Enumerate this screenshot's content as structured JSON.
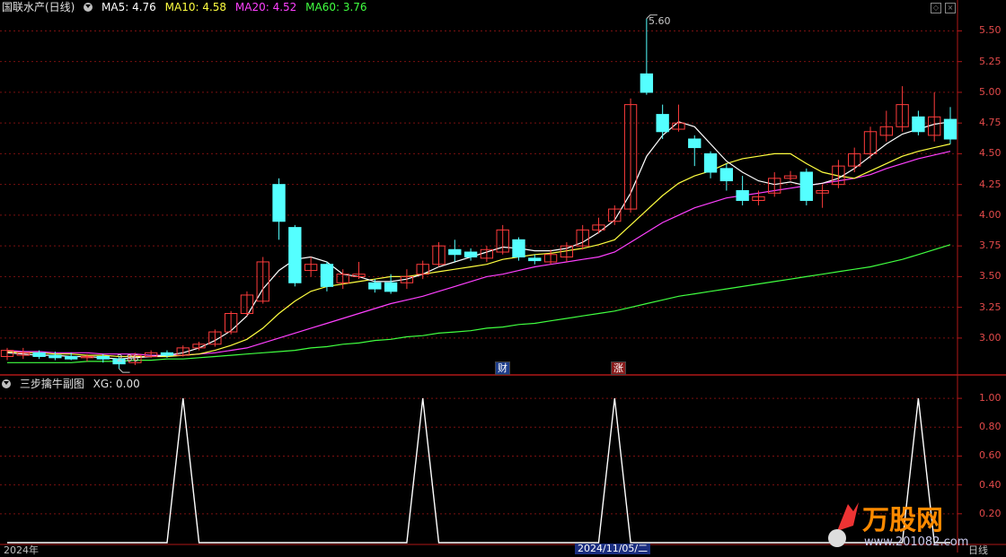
{
  "main": {
    "title": "国联水产(日线)",
    "ma": [
      {
        "label": "MA5: 4.76",
        "color": "#ffffff"
      },
      {
        "label": "MA10: 4.58",
        "color": "#ffff40"
      },
      {
        "label": "MA20: 4.52",
        "color": "#ff40ff"
      },
      {
        "label": "MA60: 3.76",
        "color": "#40ff40"
      }
    ],
    "axis_ticks": [
      "5.50",
      "5.25",
      "5.00",
      "4.75",
      "4.50",
      "4.25",
      "4.00",
      "3.75",
      "3.50",
      "3.25",
      "3.00"
    ],
    "high_note": "5.60",
    "low_note": "2.86",
    "tag_cai": "财",
    "tag_zhang": "涨"
  },
  "sub": {
    "title": "三步擒牛副图",
    "value": "XG: 0.00",
    "axis_ticks": [
      "1.00",
      "0.80",
      "0.60",
      "0.40",
      "0.20"
    ]
  },
  "bottom": {
    "left_year": "2024年",
    "date_box": "2024/11/05/二",
    "right_label": "日线"
  },
  "colors": {
    "bg": "#000000",
    "up": "#ff3c3c",
    "down": "#54ffff",
    "grid": "#7a1010",
    "ma5": "#ffffff",
    "ma10": "#ffff40",
    "ma20": "#ff40ff",
    "ma60": "#40ff40",
    "axis": "#b01818"
  },
  "chart_data": {
    "type": "candlestick",
    "y_range": [
      2.7,
      5.62
    ],
    "sub_y_range": [
      0,
      1.1
    ],
    "candles": [
      [
        2.85,
        2.9,
        2.92,
        2.82
      ],
      [
        2.86,
        2.88,
        2.92,
        2.83
      ],
      [
        2.88,
        2.85,
        2.9,
        2.83
      ],
      [
        2.86,
        2.84,
        2.89,
        2.82
      ],
      [
        2.85,
        2.83,
        2.88,
        2.82
      ],
      [
        2.84,
        2.85,
        2.87,
        2.81
      ],
      [
        2.85,
        2.83,
        2.87,
        2.8
      ],
      [
        2.83,
        2.79,
        2.85,
        2.75
      ],
      [
        2.8,
        2.86,
        2.88,
        2.78
      ],
      [
        2.85,
        2.88,
        2.9,
        2.84
      ],
      [
        2.88,
        2.86,
        2.9,
        2.84
      ],
      [
        2.86,
        2.92,
        2.94,
        2.85
      ],
      [
        2.92,
        2.95,
        2.97,
        2.9
      ],
      [
        2.95,
        3.05,
        3.07,
        2.93
      ],
      [
        3.05,
        3.2,
        3.22,
        3.03
      ],
      [
        3.2,
        3.35,
        3.38,
        3.18
      ],
      [
        3.3,
        3.62,
        3.66,
        3.28
      ],
      [
        4.25,
        3.95,
        4.3,
        3.8
      ],
      [
        3.9,
        3.45,
        3.92,
        3.42
      ],
      [
        3.55,
        3.6,
        3.66,
        3.5
      ],
      [
        3.6,
        3.42,
        3.62,
        3.38
      ],
      [
        3.45,
        3.52,
        3.56,
        3.4
      ],
      [
        3.5,
        3.52,
        3.62,
        3.48
      ],
      [
        3.45,
        3.4,
        3.48,
        3.37
      ],
      [
        3.45,
        3.38,
        3.52,
        3.36
      ],
      [
        3.45,
        3.5,
        3.56,
        3.4
      ],
      [
        3.52,
        3.6,
        3.63,
        3.48
      ],
      [
        3.6,
        3.75,
        3.78,
        3.58
      ],
      [
        3.72,
        3.68,
        3.8,
        3.62
      ],
      [
        3.7,
        3.66,
        3.73,
        3.63
      ],
      [
        3.65,
        3.72,
        3.75,
        3.62
      ],
      [
        3.7,
        3.88,
        3.92,
        3.68
      ],
      [
        3.8,
        3.66,
        3.82,
        3.63
      ],
      [
        3.65,
        3.63,
        3.68,
        3.6
      ],
      [
        3.62,
        3.68,
        3.72,
        3.6
      ],
      [
        3.66,
        3.75,
        3.78,
        3.62
      ],
      [
        3.75,
        3.88,
        3.92,
        3.72
      ],
      [
        3.88,
        3.92,
        3.98,
        3.85
      ],
      [
        3.95,
        4.05,
        4.08,
        3.92
      ],
      [
        4.05,
        4.9,
        4.95,
        4.02
      ],
      [
        5.15,
        5.0,
        5.6,
        4.98
      ],
      [
        4.82,
        4.68,
        4.9,
        4.62
      ],
      [
        4.7,
        4.75,
        4.9,
        4.68
      ],
      [
        4.62,
        4.55,
        4.65,
        4.4
      ],
      [
        4.5,
        4.35,
        4.52,
        4.3
      ],
      [
        4.38,
        4.28,
        4.42,
        4.2
      ],
      [
        4.2,
        4.12,
        4.32,
        4.08
      ],
      [
        4.12,
        4.15,
        4.2,
        4.08
      ],
      [
        4.18,
        4.3,
        4.35,
        4.15
      ],
      [
        4.3,
        4.32,
        4.36,
        4.28
      ],
      [
        4.35,
        4.12,
        4.38,
        4.08
      ],
      [
        4.18,
        4.2,
        4.25,
        4.06
      ],
      [
        4.25,
        4.4,
        4.45,
        4.22
      ],
      [
        4.4,
        4.5,
        4.55,
        4.35
      ],
      [
        4.5,
        4.68,
        4.72,
        4.46
      ],
      [
        4.65,
        4.72,
        4.85,
        4.6
      ],
      [
        4.72,
        4.9,
        5.05,
        4.68
      ],
      [
        4.8,
        4.68,
        4.85,
        4.65
      ],
      [
        4.65,
        4.8,
        5.0,
        4.6
      ],
      [
        4.78,
        4.62,
        4.88,
        4.58
      ]
    ],
    "ma5": [
      2.88,
      2.87,
      2.86,
      2.86,
      2.85,
      2.85,
      2.84,
      2.83,
      2.84,
      2.85,
      2.86,
      2.88,
      2.92,
      2.98,
      3.06,
      3.18,
      3.4,
      3.55,
      3.64,
      3.66,
      3.62,
      3.52,
      3.5,
      3.46,
      3.46,
      3.48,
      3.52,
      3.58,
      3.62,
      3.66,
      3.7,
      3.74,
      3.73,
      3.71,
      3.71,
      3.73,
      3.78,
      3.86,
      3.96,
      4.18,
      4.48,
      4.65,
      4.76,
      4.72,
      4.58,
      4.44,
      4.35,
      4.28,
      4.25,
      4.27,
      4.24,
      4.26,
      4.3,
      4.38,
      4.48,
      4.58,
      4.66,
      4.7,
      4.74,
      4.76
    ],
    "ma10": [
      2.89,
      2.88,
      2.88,
      2.87,
      2.87,
      2.86,
      2.86,
      2.85,
      2.85,
      2.85,
      2.85,
      2.86,
      2.87,
      2.9,
      2.94,
      2.99,
      3.08,
      3.2,
      3.3,
      3.38,
      3.42,
      3.44,
      3.46,
      3.48,
      3.5,
      3.5,
      3.52,
      3.54,
      3.56,
      3.58,
      3.6,
      3.64,
      3.66,
      3.68,
      3.69,
      3.71,
      3.73,
      3.76,
      3.8,
      3.92,
      4.04,
      4.16,
      4.26,
      4.32,
      4.36,
      4.42,
      4.46,
      4.48,
      4.5,
      4.5,
      4.42,
      4.35,
      4.32,
      4.3,
      4.36,
      4.42,
      4.48,
      4.52,
      4.55,
      4.58
    ],
    "ma20": [
      2.9,
      2.89,
      2.89,
      2.88,
      2.88,
      2.88,
      2.87,
      2.87,
      2.87,
      2.86,
      2.86,
      2.86,
      2.87,
      2.88,
      2.9,
      2.92,
      2.96,
      3.0,
      3.04,
      3.08,
      3.12,
      3.16,
      3.2,
      3.24,
      3.28,
      3.31,
      3.34,
      3.38,
      3.42,
      3.46,
      3.5,
      3.52,
      3.55,
      3.58,
      3.6,
      3.62,
      3.64,
      3.66,
      3.7,
      3.78,
      3.86,
      3.94,
      4.0,
      4.06,
      4.1,
      4.14,
      4.16,
      4.18,
      4.2,
      4.22,
      4.24,
      4.26,
      4.28,
      4.3,
      4.33,
      4.38,
      4.42,
      4.46,
      4.49,
      4.52
    ],
    "ma60": [
      2.8,
      2.8,
      2.8,
      2.8,
      2.8,
      2.81,
      2.81,
      2.81,
      2.82,
      2.82,
      2.83,
      2.83,
      2.84,
      2.85,
      2.86,
      2.87,
      2.88,
      2.89,
      2.9,
      2.92,
      2.93,
      2.95,
      2.96,
      2.98,
      2.99,
      3.01,
      3.02,
      3.04,
      3.05,
      3.06,
      3.08,
      3.09,
      3.11,
      3.12,
      3.14,
      3.16,
      3.18,
      3.2,
      3.22,
      3.25,
      3.28,
      3.31,
      3.34,
      3.36,
      3.38,
      3.4,
      3.42,
      3.44,
      3.46,
      3.48,
      3.5,
      3.52,
      3.54,
      3.56,
      3.58,
      3.61,
      3.64,
      3.68,
      3.72,
      3.76
    ],
    "xg": [
      0,
      0,
      0,
      0,
      0,
      0,
      0,
      0,
      0,
      0,
      0,
      1,
      0,
      0,
      0,
      0,
      0,
      0,
      0,
      0,
      0,
      0,
      0,
      0,
      0,
      0,
      1,
      0,
      0,
      0,
      0,
      0,
      0,
      0,
      0,
      0,
      0,
      0,
      1,
      0,
      0,
      0,
      0,
      0,
      0,
      0,
      0,
      0,
      0,
      0,
      0,
      0,
      0,
      0,
      0,
      0,
      0,
      1,
      0,
      0
    ]
  }
}
